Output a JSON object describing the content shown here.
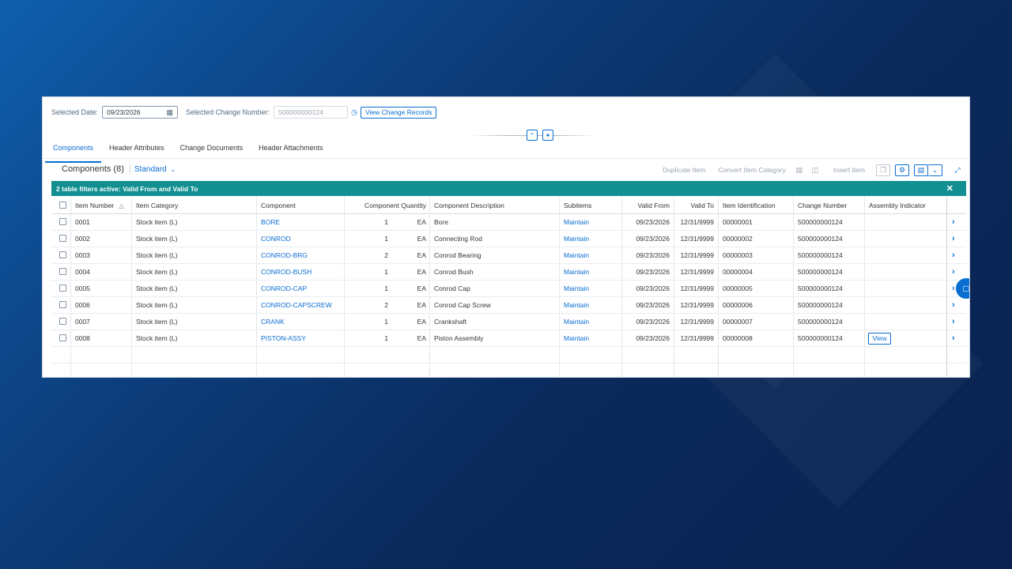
{
  "filter_bar": {
    "selected_date_label": "Selected Date:",
    "selected_date_value": "09/23/2026",
    "change_number_label": "Selected Change Number:",
    "change_number_placeholder": "500000000124",
    "view_change_records_label": "View Change Records"
  },
  "tabs": [
    {
      "label": "Components",
      "active": true
    },
    {
      "label": "Header Attributes",
      "active": false
    },
    {
      "label": "Change Documents",
      "active": false
    },
    {
      "label": "Header Attachments",
      "active": false
    }
  ],
  "toolbar": {
    "title": "Components (8)",
    "variant": "Standard",
    "duplicate_item": "Duplicate Item",
    "convert_item_category": "Convert Item Category",
    "insert_item": "Insert Item"
  },
  "info_bar": {
    "text": "2 table filters active: Valid From and Valid To"
  },
  "table": {
    "headers": {
      "item_number": "Item Number",
      "item_category": "Item Category",
      "component": "Component",
      "component_quantity": "Component Quantity",
      "component_description": "Component Description",
      "subitems": "Subitems",
      "valid_from": "Valid From",
      "valid_to": "Valid To",
      "item_identification": "Item Identification",
      "change_number": "Change Number",
      "assembly_indicator": "Assembly Indicator"
    },
    "rows": [
      {
        "item": "0001",
        "category": "Stock item (L)",
        "component": "BORE",
        "qty": "1",
        "unit": "EA",
        "description": "Bore",
        "subitems": "Maintain",
        "valid_from": "09/23/2026",
        "valid_to": "12/31/9999",
        "item_id": "00000001",
        "change_number": "500000000124",
        "assembly": ""
      },
      {
        "item": "0002",
        "category": "Stock item (L)",
        "component": "CONROD",
        "qty": "1",
        "unit": "EA",
        "description": "Connecting Rod",
        "subitems": "Maintain",
        "valid_from": "09/23/2026",
        "valid_to": "12/31/9999",
        "item_id": "00000002",
        "change_number": "500000000124",
        "assembly": ""
      },
      {
        "item": "0003",
        "category": "Stock item (L)",
        "component": "CONROD-BRG",
        "qty": "2",
        "unit": "EA",
        "description": "Conrod Bearing",
        "subitems": "Maintain",
        "valid_from": "09/23/2026",
        "valid_to": "12/31/9999",
        "item_id": "00000003",
        "change_number": "500000000124",
        "assembly": ""
      },
      {
        "item": "0004",
        "category": "Stock item (L)",
        "component": "CONROD-BUSH",
        "qty": "1",
        "unit": "EA",
        "description": "Conrod Bush",
        "subitems": "Maintain",
        "valid_from": "09/23/2026",
        "valid_to": "12/31/9999",
        "item_id": "00000004",
        "change_number": "500000000124",
        "assembly": ""
      },
      {
        "item": "0005",
        "category": "Stock item (L)",
        "component": "CONROD-CAP",
        "qty": "1",
        "unit": "EA",
        "description": "Conrod Cap",
        "subitems": "Maintain",
        "valid_from": "09/23/2026",
        "valid_to": "12/31/9999",
        "item_id": "00000005",
        "change_number": "500000000124",
        "assembly": ""
      },
      {
        "item": "0006",
        "category": "Stock item (L)",
        "component": "CONROD-CAPSCREW",
        "qty": "2",
        "unit": "EA",
        "description": "Conrod Cap Screw",
        "subitems": "Maintain",
        "valid_from": "09/23/2026",
        "valid_to": "12/31/9999",
        "item_id": "00000006",
        "change_number": "500000000124",
        "assembly": ""
      },
      {
        "item": "0007",
        "category": "Stock item (L)",
        "component": "CRANK",
        "qty": "1",
        "unit": "EA",
        "description": "Crankshaft",
        "subitems": "Maintain",
        "valid_from": "09/23/2026",
        "valid_to": "12/31/9999",
        "item_id": "00000007",
        "change_number": "500000000124",
        "assembly": ""
      },
      {
        "item": "0008",
        "category": "Stock item (L)",
        "component": "PISTON-ASSY",
        "qty": "1",
        "unit": "EA",
        "description": "Piston Assembly",
        "subitems": "Maintain",
        "valid_from": "09/23/2026",
        "valid_to": "12/31/9999",
        "item_id": "00000008",
        "change_number": "500000000124",
        "assembly": "View"
      }
    ]
  },
  "colors": {
    "accent": "#0a6ed1",
    "info_bar": "#118f91"
  }
}
